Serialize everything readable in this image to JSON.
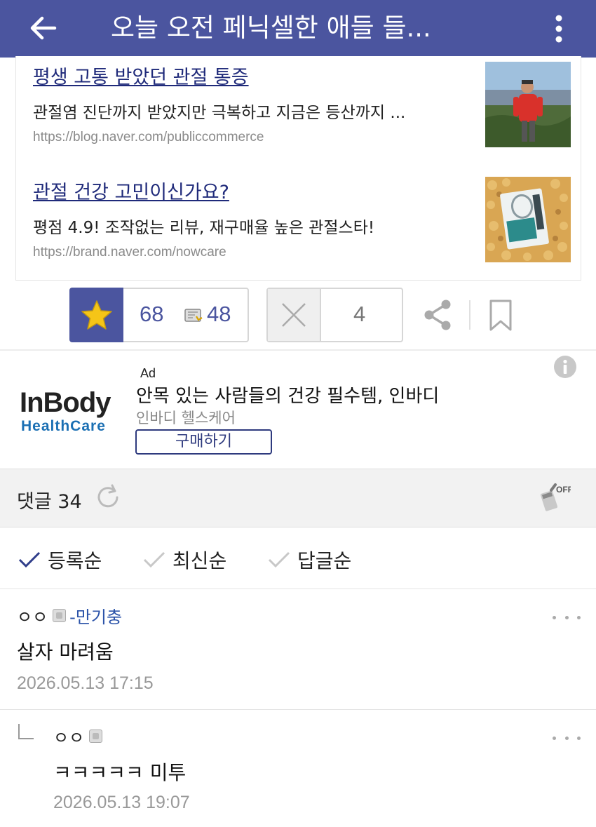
{
  "topbar": {
    "title": "오늘 오전 페닉셀한 애들 들..."
  },
  "ads": [
    {
      "title": "평생 고통 받았던 관절 통증",
      "desc": "관절염 진단까지 받았지만 극복하고 지금은 등산까지 ...",
      "url": "https://blog.naver.com/publiccommerce",
      "thumb_icon": "hiker-photo"
    },
    {
      "title": "관절 건강 고민이신가요?",
      "desc": "평점 4.9! 조작없는 리뷰, 재구매율 높은 관절스타!",
      "url": "https://brand.naver.com/nowcare",
      "thumb_icon": "supplement-box-photo"
    }
  ],
  "actions": {
    "upvotes": "68",
    "comment_count": "48",
    "downvotes": "4"
  },
  "banner": {
    "logo_line1": "InBody",
    "logo_line2": "HealthCare",
    "ad_label": "Ad",
    "title": "안목 있는 사람들의 건강 필수템, 인바디",
    "subtitle": "인바디 헬스케어",
    "button": "구매하기"
  },
  "comments_header": {
    "label": "댓글 34"
  },
  "sort_tabs": [
    {
      "label": "등록순",
      "active": true
    },
    {
      "label": "최신순",
      "active": false
    },
    {
      "label": "답글순",
      "active": false
    }
  ],
  "comments": [
    {
      "nick": "ㅇㅇ",
      "tag": "-만기충",
      "text": "살자 마려움",
      "date": "2026.05.13 17:15"
    },
    {
      "nick": "ㅇㅇ",
      "tag": "",
      "text": "ㅋㅋㅋㅋㅋ 미투",
      "date": "2026.05.13 19:07",
      "is_reply": true
    }
  ],
  "colors": {
    "brand": "#4b559f",
    "link": "#1f2a7a",
    "star": "#f5c518"
  }
}
